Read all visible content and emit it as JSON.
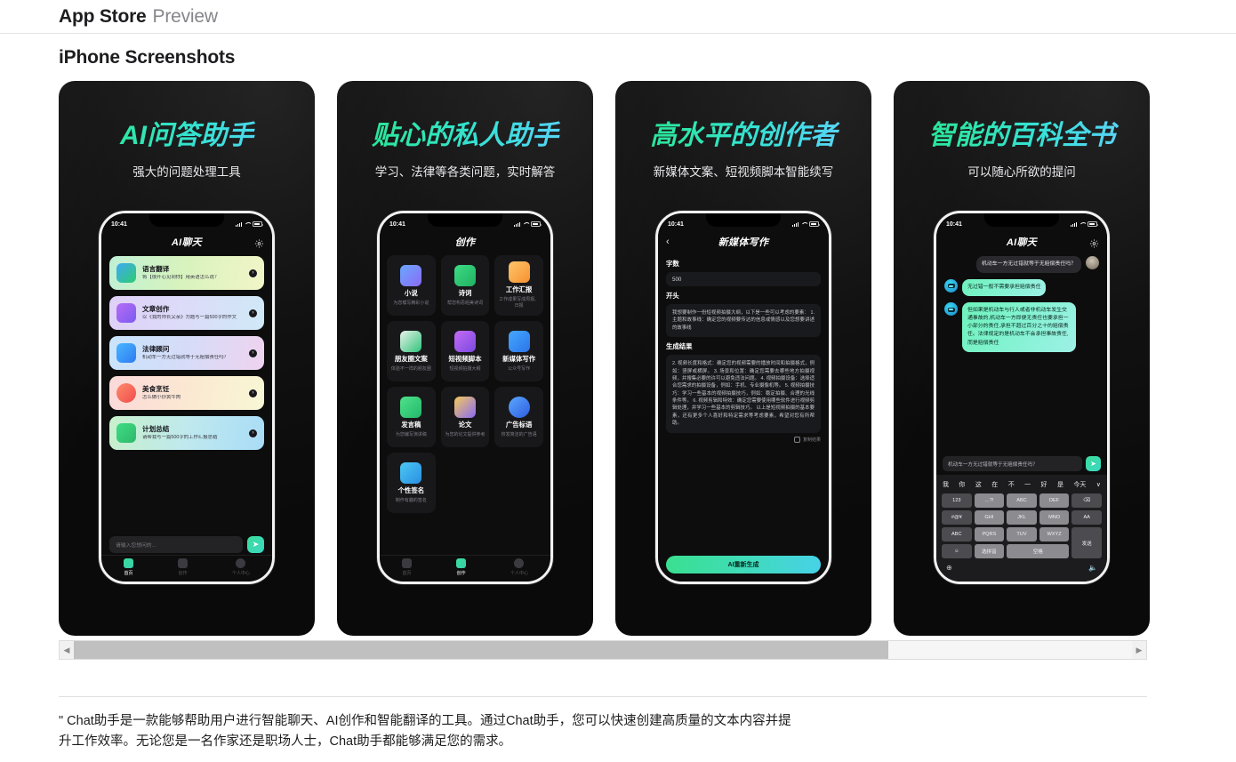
{
  "topbar": {
    "title": "App Store",
    "subtitle": "Preview"
  },
  "section": {
    "title": "iPhone Screenshots"
  },
  "scrollbar": {
    "left_arrow": "◀",
    "right_arrow": "▶",
    "thumb_percent": 77
  },
  "description": {
    "text": "\" Chat助手是一款能够帮助用户进行智能聊天、AI创作和智能翻译的工具。通过Chat助手，您可以快速创建高质量的文本内容并提升工作效率。无论您是一名作家还是职场人士，Chat助手都能够满足您的需求。"
  },
  "colors": {
    "accent_green": "#22e48b",
    "accent_cyan": "#4fd7f0",
    "panel_dark": "#111111",
    "text_primary": "#1d1d1f",
    "text_secondary": "#86868b"
  },
  "shots": [
    {
      "title": "AI问答助手",
      "subtitle": "强大的问题处理工具",
      "status_time": "10:41",
      "app_title": "AI聊天",
      "cards": [
        {
          "title": "语言翻译",
          "desc": "将【很开心见到你】用英语怎么说？"
        },
        {
          "title": "文章创作",
          "desc": "以《我的师长父亲》为题写一篇500字的作文"
        },
        {
          "title": "法律顾问",
          "desc": "机动车一方无过错就等于无赔偿责任吗？"
        },
        {
          "title": "美食烹饪",
          "desc": "怎么做小炒黄牛肉"
        },
        {
          "title": "计划总结",
          "desc": "请帮我写一篇500字的工作汇报总结"
        }
      ],
      "input_placeholder": "请输入您想问的...",
      "tabs": [
        {
          "label": "首页",
          "active": true
        },
        {
          "label": "创作",
          "active": false
        },
        {
          "label": "个人中心",
          "active": false
        }
      ]
    },
    {
      "title": "贴心的私人助手",
      "subtitle": "学习、法律等各类问题，实时解答",
      "status_time": "10:41",
      "app_title": "创作",
      "grid": [
        {
          "title": "小说",
          "desc": "为您模写精彩小说"
        },
        {
          "title": "诗词",
          "desc": "帮您构思组美诗词"
        },
        {
          "title": "工作汇报",
          "desc": "工作成果写成周报、日报"
        },
        {
          "title": "朋友圈文案",
          "desc": "体验不一样的朋友圈"
        },
        {
          "title": "短视频脚本",
          "desc": "短视频拍摄大纲"
        },
        {
          "title": "新媒体写作",
          "desc": "公众号写作"
        },
        {
          "title": "发言稿",
          "desc": "为您编写演讲稿"
        },
        {
          "title": "论文",
          "desc": "为您的论文提供参考"
        },
        {
          "title": "广告标语",
          "desc": "校发简洁的广告语"
        },
        {
          "title": "个性签名",
          "desc": "制作有趣的签名"
        }
      ],
      "tabs": [
        {
          "label": "首页",
          "active": false
        },
        {
          "label": "创作",
          "active": true
        },
        {
          "label": "个人中心",
          "active": false
        }
      ]
    },
    {
      "title": "高水平的创作者",
      "subtitle": "新媒体文案、短视频脚本智能续写",
      "status_time": "10:41",
      "app_title": "新媒体写作",
      "back_icon": "‹",
      "fields": {
        "count_label": "字数",
        "count_value": "500",
        "opening_label": "开头",
        "opening_value": "我想要制作一份短视频拍摄大纲，以下是一些可以考虑的要素：\n1. 主题和故事线：确定您的视频要传达的信息或情感以及您想要讲述的故事线",
        "result_label": "生成结果",
        "result_value": "2. 视频长度和格式：确定您的视频需要的播放时间和拍摄格式，例如：竖屏或横屏。\n3. 场景和位置：确定您需要去哪些地方拍摄视频，并搜集必要的许可以避免违法问题。\n4. 视频拍摄设备：选择适合您需求的拍摄设备，例如：手机、专业摄像机等。\n5. 视频拍摄技巧：学习一些基本的视频拍摄技巧，例如：稳定拍摄、合理的光线条件等。\n6. 视频剪辑和特效：确定您需要使用哪些软件进行视频剪辑处理，并学习一些基本的剪辑技巧。\n以上是短视频拍摄的基本要素，还有更多个人喜好和特定需求等考虑要素，希望对您有所帮助。"
      },
      "copy_label": "复制结果",
      "generate_label": "AI重新生成"
    },
    {
      "title": "智能的百科全书",
      "subtitle": "可以随心所欲的提问",
      "status_time": "10:41",
      "app_title": "AI聊天",
      "messages": [
        {
          "from": "user",
          "text": "机动车一方无过错就等于无赔偿责任吗？"
        },
        {
          "from": "ai",
          "text": "无过错一般不需要承担赔偿责任"
        },
        {
          "from": "ai",
          "text": "但如果是机动车与行人或者非机动车发生交通事故的,机动车一方即便无责任也要承担一小部分的责任,承担不超过百分之十的赔偿责任。法律规定的是机动车不会承担事故责任,而是赔偿责任"
        }
      ],
      "input_value": "机动车一方无过错就等于无赔偿责任吗？",
      "keyboard": {
        "suggestions": [
          "我",
          "你",
          "这",
          "在",
          "不",
          "一",
          "好",
          "是",
          "今天"
        ],
        "collapse_icon": "∨",
        "keys": [
          "123",
          "…?!",
          "ABC",
          "DEF",
          "⌫",
          "#@¥",
          "GHI",
          "JKL",
          "MNO",
          "AA",
          "ABC",
          "PQRS",
          "TUV",
          "WXYZ",
          "发送",
          "☺",
          "选拼音",
          "空格"
        ],
        "globe_icon": "⊕",
        "mic_icon": "·"
      }
    }
  ]
}
